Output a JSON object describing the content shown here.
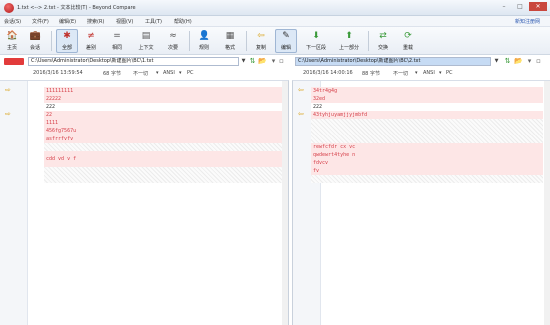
{
  "window": {
    "title": "1.txt <--> 2.txt - 文本比较(T) - Beyond Compare",
    "buttons": [
      "–",
      "□",
      "✕"
    ]
  },
  "menu": {
    "items": [
      "会话(S)",
      "文件(F)",
      "编辑(E)",
      "搜索(R)",
      "视图(V)",
      "工具(T)",
      "帮助(H)"
    ],
    "register": "新知注册网"
  },
  "toolbar": {
    "buttons": [
      {
        "label": "主页",
        "icon": "home-icon",
        "glyph": "🏠"
      },
      {
        "label": "会话",
        "icon": "session-icon",
        "glyph": "💼"
      },
      {
        "label": "全部",
        "icon": "all-icon",
        "glyph": "✱"
      },
      {
        "label": "差别",
        "icon": "diff-icon",
        "glyph": "≠"
      },
      {
        "label": "相同",
        "icon": "same-icon",
        "glyph": "="
      },
      {
        "label": "上下文",
        "icon": "context-icon",
        "glyph": "▤"
      },
      {
        "label": "次要",
        "icon": "minor-icon",
        "glyph": "≈"
      },
      {
        "label": "规则",
        "icon": "rules-icon",
        "glyph": "👤"
      },
      {
        "label": "格式",
        "icon": "format-icon",
        "glyph": "▦"
      },
      {
        "label": "复制",
        "icon": "copy-icon",
        "glyph": "⇦"
      },
      {
        "label": "编辑",
        "icon": "edit-icon",
        "glyph": "✎"
      },
      {
        "label": "下一区段",
        "icon": "next-section-icon",
        "glyph": "⬇"
      },
      {
        "label": "上一部分",
        "icon": "prev-section-icon",
        "glyph": "⬆"
      },
      {
        "label": "交换",
        "icon": "swap-icon",
        "glyph": "⇄"
      },
      {
        "label": "重载",
        "icon": "reload-icon",
        "glyph": "⟳"
      }
    ]
  },
  "left": {
    "path": "C:\\Users\\Administrator\\Desktop\\新建图片\\BC\\1.txt",
    "date": "2016/3/16 13:59:54",
    "size": "68 字节",
    "mode": "不一切",
    "encoding": "ANSI",
    "platform": "PC"
  },
  "right": {
    "path": "C:\\Users\\Administrator\\Desktop\\新建图片\\BC\\2.txt",
    "date": "2016/3/16 14:00:16",
    "size": "88 字节",
    "mode": "不一切",
    "encoding": "ANSI",
    "platform": "PC"
  },
  "left_lines": [
    "111111111",
    "22222",
    "222",
    "22",
    "1111",
    "456fg7567u",
    "asfrrfvfv",
    "",
    "cdd vd v f",
    ""
  ],
  "right_lines": [
    "34tr4g4g",
    "32ed",
    "222",
    "43tyhjuyamjjyjmbfd",
    "",
    "",
    "rewfcfdr cx vc",
    "qwdewrt4tyhe n",
    "fdvcv",
    "fv"
  ],
  "colors": {
    "diff_text": "#d6404a",
    "diff_bg": "#fde6e6",
    "accent": "#e23b3b"
  }
}
